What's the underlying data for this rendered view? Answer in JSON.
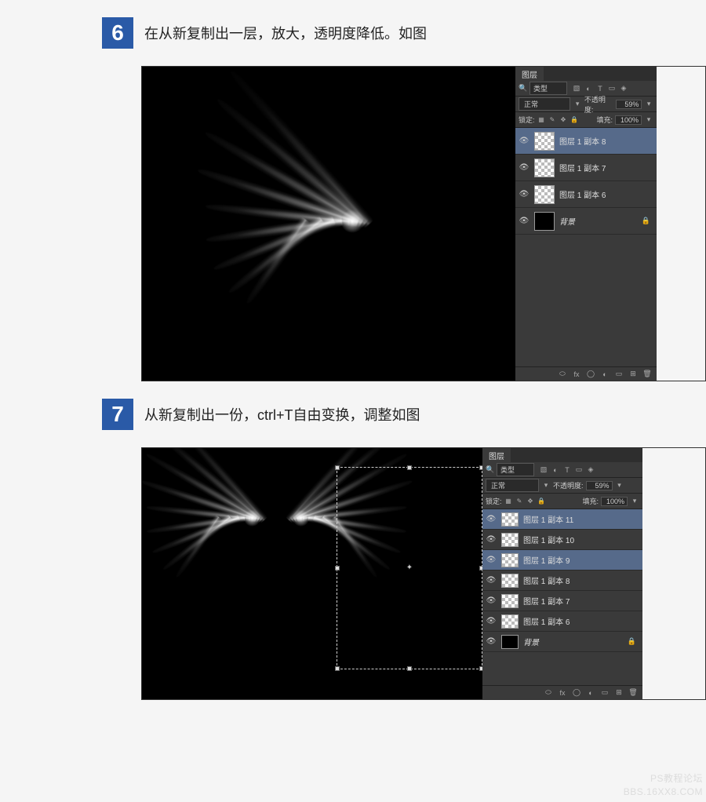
{
  "steps": {
    "s6": {
      "num": "6",
      "text": "在从新复制出一层，放大，透明度降低。如图"
    },
    "s7": {
      "num": "7",
      "text": "从新复制出一份，ctrl+T自由变换，调整如图"
    }
  },
  "panel": {
    "tab": "图层",
    "type_label": "类型",
    "blend_mode": "正常",
    "opacity_label": "不透明度:",
    "opacity_value": "59%",
    "lock_label": "锁定:",
    "fill_label": "填充:",
    "fill_value": "100%"
  },
  "layers6": [
    {
      "name": "图层 1 副本 8",
      "selected": true,
      "bg": false
    },
    {
      "name": "图层 1 副本 7",
      "selected": false,
      "bg": false
    },
    {
      "name": "图层 1 副本 6",
      "selected": false,
      "bg": false
    },
    {
      "name": "背景",
      "selected": false,
      "bg": true
    }
  ],
  "layers7": [
    {
      "name": "图层 1 副本 11",
      "selected": true,
      "bg": false
    },
    {
      "name": "图层 1 副本 10",
      "selected": false,
      "bg": false
    },
    {
      "name": "图层 1 副本 9",
      "selected": true,
      "bg": false
    },
    {
      "name": "图层 1 副本 8",
      "selected": false,
      "bg": false
    },
    {
      "name": "图层 1 副本 7",
      "selected": false,
      "bg": false
    },
    {
      "name": "图层 1 副本 6",
      "selected": false,
      "bg": false
    },
    {
      "name": "背景",
      "selected": false,
      "bg": true
    }
  ],
  "watermark": {
    "line1": "PS教程论坛",
    "line2": "BBS.16XX8.COM"
  }
}
